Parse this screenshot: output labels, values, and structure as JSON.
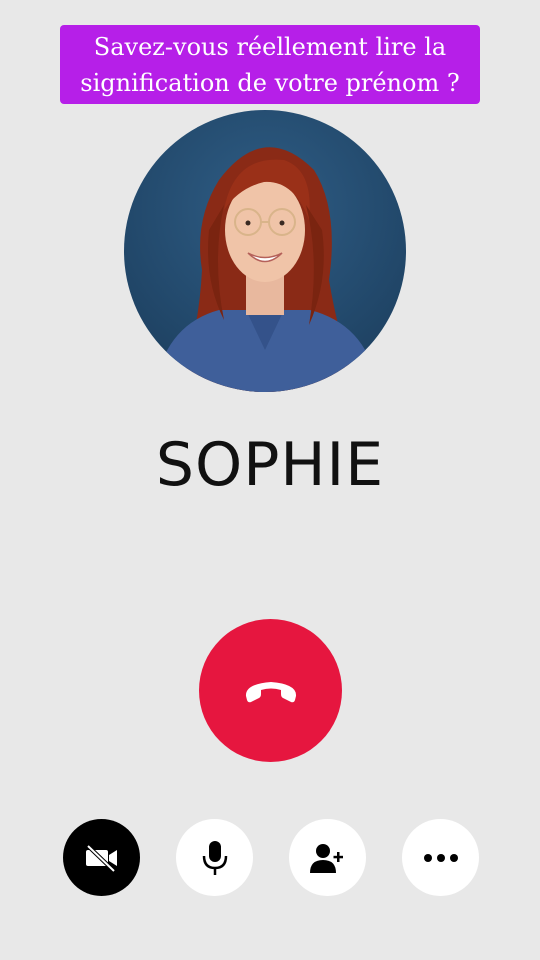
{
  "banner": {
    "line1": "Savez-vous réellement lire la",
    "line2": "signification de votre prénom ?"
  },
  "caller": {
    "name": "SOPHIE"
  },
  "colors": {
    "banner_bg": "#b61fe8",
    "end_call": "#e6163f",
    "background": "#e8e8e8"
  },
  "controls": {
    "icons": [
      "video-off-icon",
      "microphone-icon",
      "add-person-icon",
      "more-icon"
    ]
  }
}
